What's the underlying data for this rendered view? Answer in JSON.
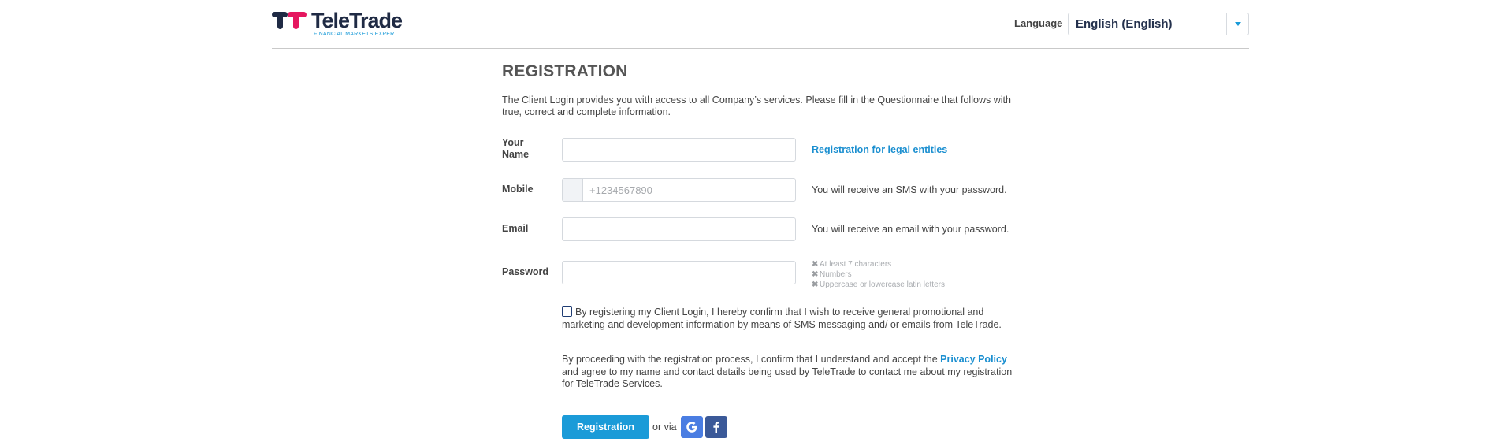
{
  "header": {
    "logo": {
      "name": "TeleTrade",
      "tagline": "FINANCIAL MARKETS EXPERT"
    },
    "language": {
      "label": "Language",
      "selected": "English (English)"
    }
  },
  "registration": {
    "title": "REGISTRATION",
    "intro": "The Client Login provides you with access to all Company’s services. Please fill in the Questionnaire that follows with true, correct and complete information.",
    "fields": {
      "name": {
        "label": "Your Name",
        "value": "",
        "side_link": "Registration for legal entities"
      },
      "mobile": {
        "label": "Mobile",
        "placeholder": "+1234567890",
        "side_text": "You will receive an SMS with your password."
      },
      "email": {
        "label": "Email",
        "value": "",
        "side_text": "You will receive an email with your password."
      },
      "password": {
        "label": "Password",
        "rules": [
          "At least 7 characters",
          "Numbers",
          "Uppercase or lowercase latin letters"
        ]
      }
    },
    "consent_text": "By registering my Client Login, I hereby confirm that I wish to receive general promotional and marketing and development information by means of SMS messaging and/ or emails from TeleTrade.",
    "privacy": {
      "before": "By proceeding with the registration process, I confirm that I understand and accept the ",
      "link": "Privacy Policy",
      "after": " and agree to my name and contact details being used by TeleTrade to contact me about my registration for TeleTrade Services."
    },
    "actions": {
      "register_label": "Registration",
      "or_via": "or via",
      "social": [
        "google-icon",
        "facebook-icon"
      ]
    }
  },
  "colors": {
    "accent": "#1b9bd8",
    "link": "#1b8fd0",
    "logo_dark": "#1f2a44",
    "logo_pink": "#e5175f",
    "google": "#4a7de2",
    "facebook": "#3b5998"
  }
}
